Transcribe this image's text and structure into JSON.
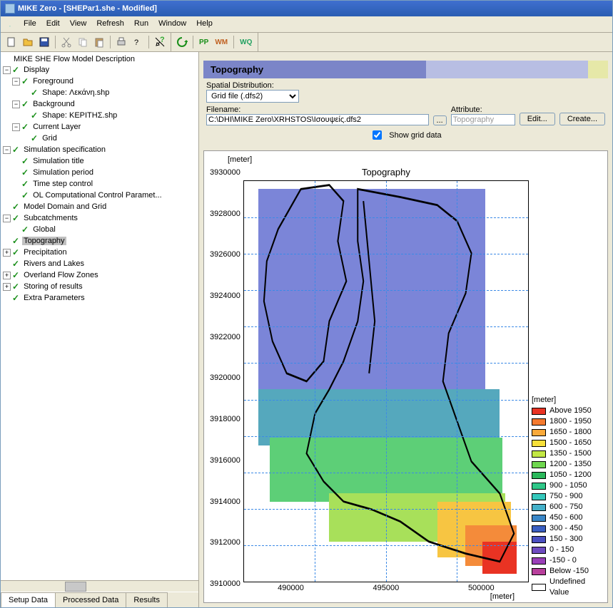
{
  "window_title": "MIKE Zero - [SHEPar1.she - Modified]",
  "menu": [
    "File",
    "Edit",
    "View",
    "Refresh",
    "Run",
    "Window",
    "Help"
  ],
  "toolbar2": {
    "pp": "PP",
    "wm": "WM",
    "wq": "WQ"
  },
  "tree": {
    "root": "MIKE SHE Flow Model Description",
    "display": "Display",
    "foreground": "Foreground",
    "fg_shape": "Shape: Λεκάνη.shp",
    "background": "Background",
    "bg_shape": "Shape: ΚΕΡΙΤΗΣ.shp",
    "current_layer": "Current Layer",
    "grid": "Grid",
    "sim_spec": "Simulation specification",
    "sim_title": "Simulation title",
    "sim_period": "Simulation period",
    "time_step": "Time step control",
    "ol_comp": "OL Computational Control Paramet...",
    "model_domain": "Model Domain and Grid",
    "subcatch": "Subcatchments",
    "global": "Global",
    "topo": "Topography",
    "precip": "Precipitation",
    "rivers": "Rivers and Lakes",
    "overland": "Overland Flow Zones",
    "storing": "Storing of results",
    "extra": "Extra Parameters"
  },
  "tabs": {
    "setup": "Setup Data",
    "processed": "Processed Data",
    "results": "Results"
  },
  "panel": {
    "title": "Topography",
    "spatial_label": "Spatial Distribution:",
    "spatial_value": "Grid file (.dfs2)",
    "filename_label": "Filename:",
    "filename": "C:\\DHI\\MIKE Zero\\XRHSTOS\\Ισουψείς.dfs2",
    "browse": "...",
    "attr_label": "Attribute:",
    "attr_value": "Topography",
    "edit": "Edit...",
    "create": "Create...",
    "show_grid": "Show grid data"
  },
  "chart": {
    "title": "Topography",
    "unit": "[meter]",
    "yticks": [
      "3930000",
      "3928000",
      "3926000",
      "3924000",
      "3922000",
      "3920000",
      "3918000",
      "3916000",
      "3914000",
      "3912000",
      "3910000"
    ],
    "xticks": [
      "490000",
      "495000",
      "500000"
    ],
    "legend_title": "[meter]",
    "legend": [
      {
        "c": "#e93323",
        "t": "Above 1950"
      },
      {
        "c": "#f47a2f",
        "t": "1800 - 1950"
      },
      {
        "c": "#f9a93a",
        "t": "1650 - 1800"
      },
      {
        "c": "#f7e03a",
        "t": "1500 - 1650"
      },
      {
        "c": "#c3e844",
        "t": "1350 - 1500"
      },
      {
        "c": "#6fd74f",
        "t": "1200 - 1350"
      },
      {
        "c": "#2bb85b",
        "t": "1050 - 1200"
      },
      {
        "c": "#2fc788",
        "t": " 900 - 1050"
      },
      {
        "c": "#35c8bc",
        "t": " 750 -  900"
      },
      {
        "c": "#44b0c9",
        "t": " 600 -  750"
      },
      {
        "c": "#3a87c8",
        "t": " 450 -  600"
      },
      {
        "c": "#3a5fc2",
        "t": " 300 -  450"
      },
      {
        "c": "#4a4fc0",
        "t": " 150 -  300"
      },
      {
        "c": "#6e4bc0",
        "t": "   0 -  150"
      },
      {
        "c": "#9a3fb8",
        "t": "-150 -    0"
      },
      {
        "c": "#b83f9c",
        "t": "Below  -150"
      },
      {
        "c": "#ffffff",
        "t": "Undefined Value"
      }
    ]
  },
  "chart_data": {
    "type": "heatmap",
    "title": "Topography",
    "xlabel": "[meter]",
    "ylabel": "[meter]",
    "xlim": [
      487000,
      502000
    ],
    "ylim": [
      3908000,
      3931000
    ],
    "color_scale_unit": "meter",
    "bins": [
      -150,
      0,
      150,
      300,
      450,
      600,
      750,
      900,
      1050,
      1200,
      1350,
      1500,
      1650,
      1800,
      1950
    ],
    "note": "Elevation map of catchment. Northern ~60% of area is 150-450 m (blue). Mid band ~3915000-3918000 transitions 450-750 m (teal). Southern band ~3911000-3915000 is 750-1200 m (green). SE corner near (500000,3910000) reaches 1500-1950+ m (orange/red)."
  }
}
